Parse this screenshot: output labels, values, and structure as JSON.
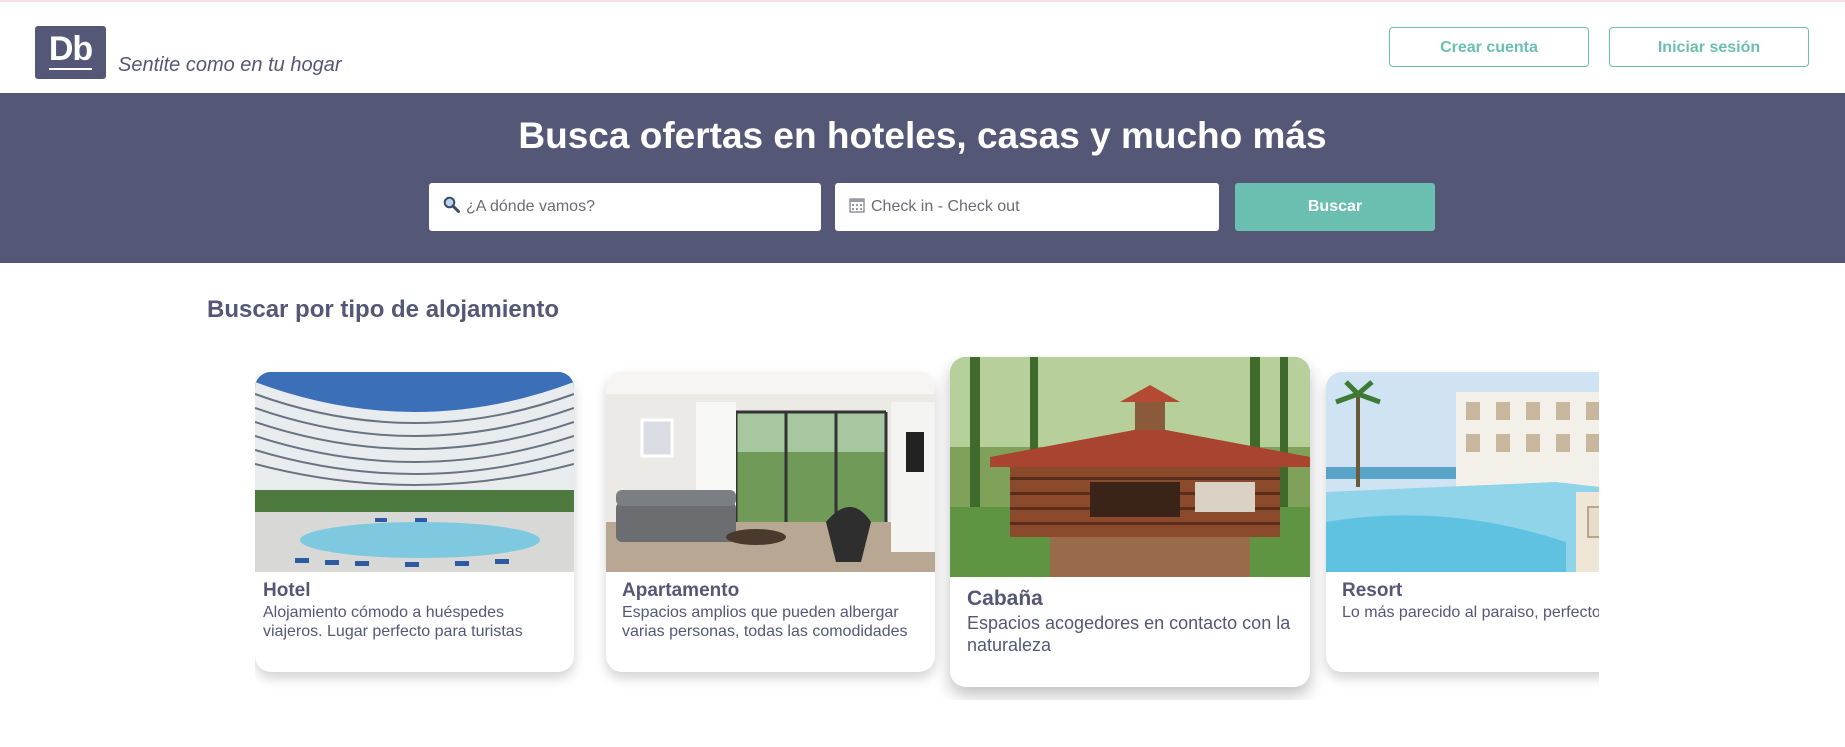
{
  "header": {
    "logo_text": "Db",
    "slogan": "Sentite como en tu hogar",
    "create_account": "Crear cuenta",
    "login": "Iniciar sesión"
  },
  "hero": {
    "title": "Busca ofertas en hoteles, casas y mucho más",
    "destination_placeholder": "¿A dónde vamos?",
    "dates_placeholder": "Check in - Check out",
    "search_button": "Buscar"
  },
  "categories": {
    "title": "Buscar por tipo de alojamiento",
    "items": [
      {
        "name": "Hotel",
        "description": "Alojamiento cómodo a huéspedes viajeros. Lugar perfecto para turistas"
      },
      {
        "name": "Apartamento",
        "description": "Espacios amplios que pueden albergar varias personas, todas las comodidades"
      },
      {
        "name": "Cabaña",
        "description": "Espacios acogedores en contacto con la naturaleza"
      },
      {
        "name": "Resort",
        "description": "Lo más parecido al paraiso, perfecto para relajarse"
      }
    ]
  },
  "colors": {
    "primary": "#545776",
    "accent": "#6bbfb0"
  },
  "icons": [
    "search-icon",
    "calendar-icon"
  ]
}
